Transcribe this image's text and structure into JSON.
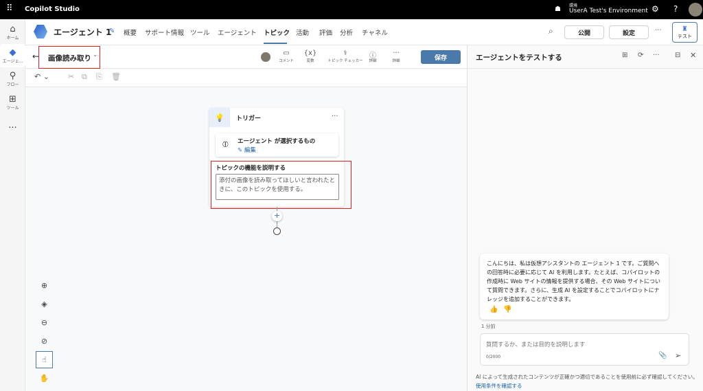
{
  "app": {
    "title": "Copilot Studio"
  },
  "env": {
    "label": "環境",
    "name": "UserA Test's Environment"
  },
  "rail": [
    {
      "label": "ホーム",
      "icon": "home-icon"
    },
    {
      "label": "エージェ...",
      "icon": "agent-icon"
    },
    {
      "label": "フロー",
      "icon": "flow-icon"
    },
    {
      "label": "ツール",
      "icon": "tools-icon"
    },
    {
      "label": "...",
      "icon": "more-icon"
    }
  ],
  "header": {
    "agent_name": "エージェント 1",
    "tabs": [
      "概要",
      "サポート情報",
      "ツール",
      "エージェント",
      "トピック",
      "活動",
      "評価",
      "分析",
      "チャネル"
    ],
    "active_tab": "トピック",
    "publish": "公開",
    "settings": "設定",
    "test": "テスト"
  },
  "topic": {
    "name": "画像読み取り",
    "tools": [
      "コメント",
      "変数",
      "トピック チェッカー",
      "詳細",
      "詳細"
    ],
    "save": "保存"
  },
  "trigger": {
    "title": "トリガー",
    "agent_selects": "エージェント が選択するもの",
    "edit": "編集",
    "describe_label": "トピックの機能を説明する",
    "describe_value": "添付の画像を読み取ってほしいと言われたときに、このトピックを使用する。"
  },
  "test_panel": {
    "title": "エージェントをテストする",
    "message": "こんにちは、私は仮想アシスタントの エージェント 1 です。ご質問への回答時に必要に応じて AI を利用します。たとえば、コパイロットの作成時に Web サイトの情報を提供する場合、その Web サイトについて質問できます。さらに、生成 AI を設定することでコパイロットにナレッジを追加することができます。",
    "time": "1 分前",
    "input_placeholder": "質問するか、または目的を説明します",
    "counter": "0/2000",
    "disclaimer": "AI によって生成されたコンテンツが正確かつ適切であることを使用前に必ず確認してください。",
    "terms_link": "使用条件を確認する"
  },
  "colors": {
    "accent": "#4a7aaa",
    "highlight": "#e02020",
    "topbar": "#000000"
  }
}
